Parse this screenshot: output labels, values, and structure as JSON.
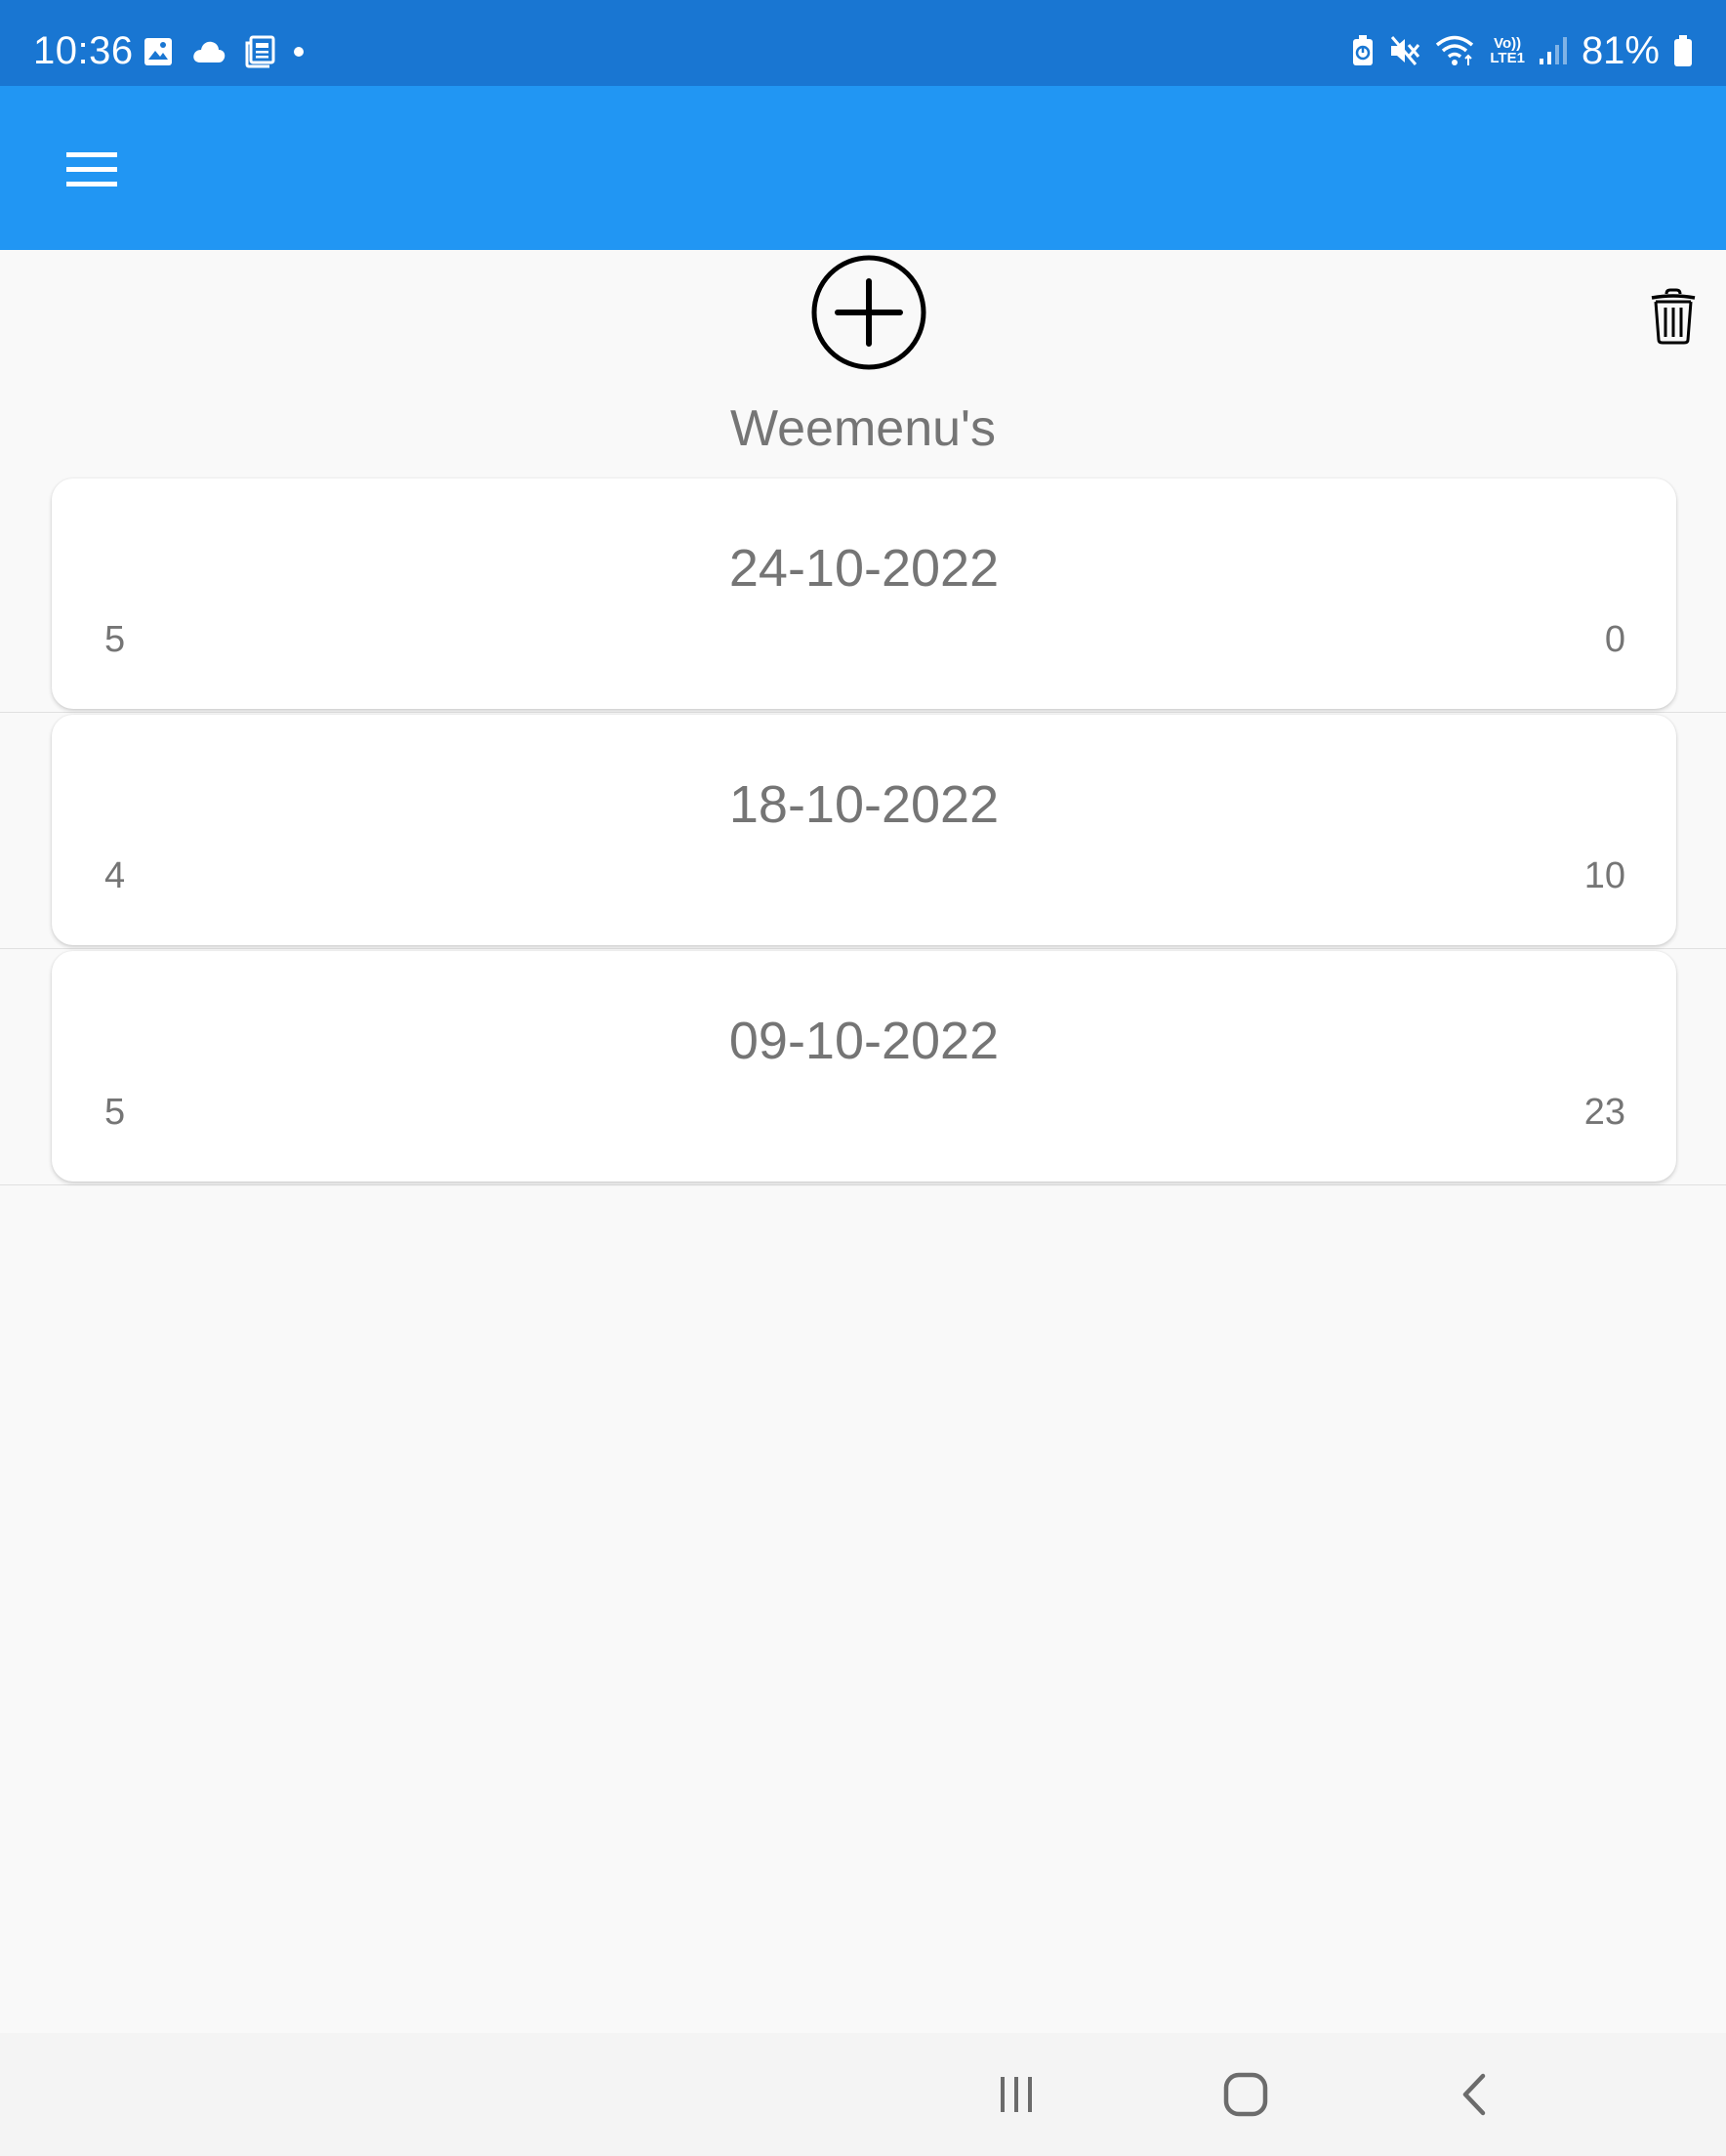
{
  "status_bar": {
    "time": "10:36",
    "left_icons": [
      "image-icon",
      "cloud-icon",
      "news-icon",
      "dot-icon"
    ],
    "right_icons": [
      "battery-saver-icon",
      "mute-icon",
      "wifi-icon",
      "volte-lte-icon",
      "signal-icon",
      "battery-icon"
    ],
    "volte_text": "Vo))",
    "lte_text": "LTE1",
    "battery_percent": "81%"
  },
  "app_bar": {
    "color": "#2196f3",
    "status_color": "#1976d2",
    "menu_icon": "menu-icon"
  },
  "toolbar": {
    "add_icon": "add-circle-icon",
    "delete_icon": "trash-icon"
  },
  "page": {
    "title": "Weemenu's"
  },
  "menus": [
    {
      "date": "24-10-2022",
      "left_value": "5",
      "right_value": "0"
    },
    {
      "date": "18-10-2022",
      "left_value": "4",
      "right_value": "10"
    },
    {
      "date": "09-10-2022",
      "left_value": "5",
      "right_value": "23"
    }
  ],
  "nav_bar": {
    "icons": [
      "recent-apps-icon",
      "home-icon",
      "back-icon"
    ]
  }
}
